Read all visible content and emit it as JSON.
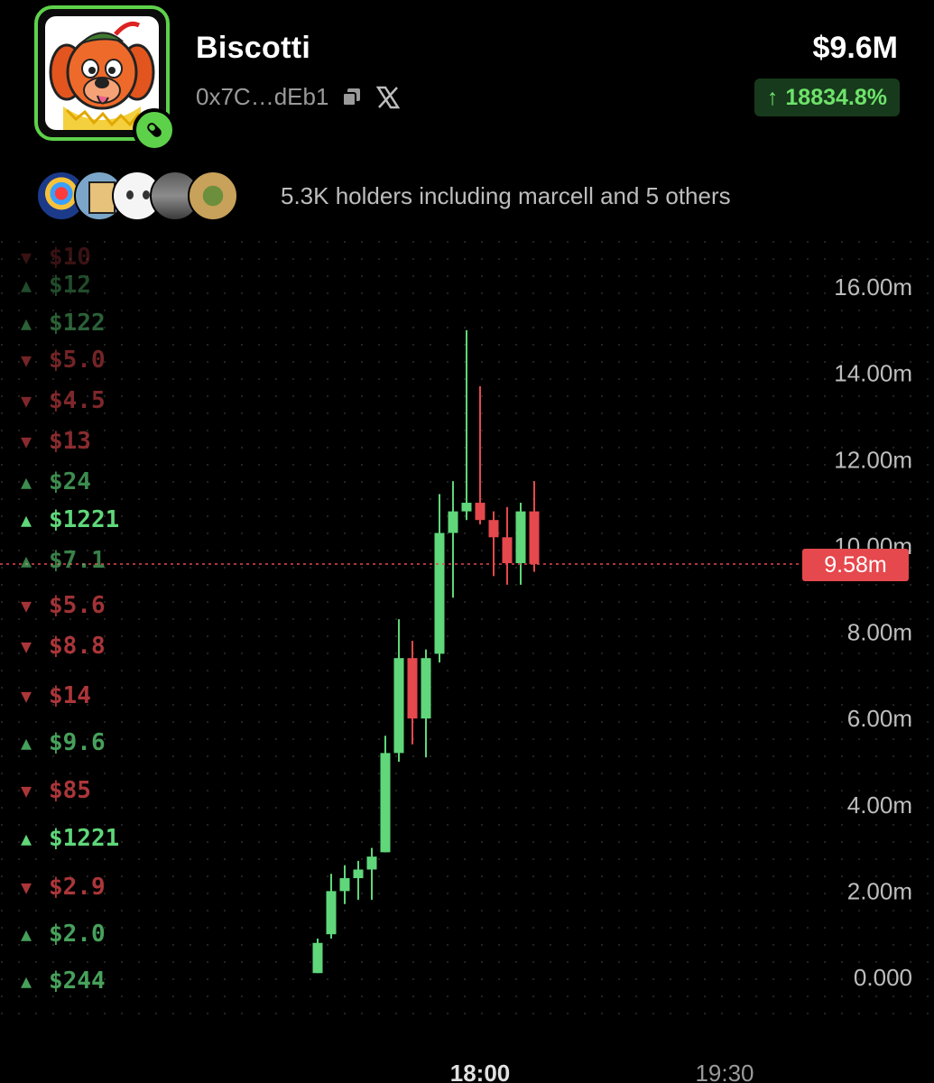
{
  "token": {
    "name": "Biscotti",
    "address": "0x7C…dEb1",
    "market_cap": "$9.6M",
    "change": "18834.8%",
    "change_arrow": "↑"
  },
  "holders": {
    "text": "5.3K holders including marcell and 5 others"
  },
  "trades": [
    {
      "dir": "down",
      "amount": "$10",
      "opacity": 0.25
    },
    {
      "dir": "up",
      "amount": "$12",
      "opacity": 0.35
    },
    {
      "dir": "up",
      "amount": "$122",
      "opacity": 0.45
    },
    {
      "dir": "down",
      "amount": "$5.0",
      "opacity": 0.5
    },
    {
      "dir": "down",
      "amount": "$4.5",
      "opacity": 0.55
    },
    {
      "dir": "down",
      "amount": "$13",
      "opacity": 0.6
    },
    {
      "dir": "up",
      "amount": "$24",
      "opacity": 0.65
    },
    {
      "dir": "up",
      "amount": "$1221",
      "opacity": 1
    },
    {
      "dir": "up",
      "amount": "$7.1",
      "opacity": 0.6
    },
    {
      "dir": "down",
      "amount": "$5.6",
      "opacity": 0.7
    },
    {
      "dir": "down",
      "amount": "$8.8",
      "opacity": 0.75
    },
    {
      "dir": "down",
      "amount": "$14",
      "opacity": 0.75
    },
    {
      "dir": "up",
      "amount": "$9.6",
      "opacity": 0.75
    },
    {
      "dir": "down",
      "amount": "$85",
      "opacity": 0.75
    },
    {
      "dir": "up",
      "amount": "$1221",
      "opacity": 1
    },
    {
      "dir": "down",
      "amount": "$2.9",
      "opacity": 0.75
    },
    {
      "dir": "up",
      "amount": "$2.0",
      "opacity": 0.75
    },
    {
      "dir": "up",
      "amount": "$244",
      "opacity": 0.75
    }
  ],
  "colors": {
    "up": "#5fd77a",
    "down": "#e5484d",
    "accent": "#5ed14b",
    "grid_dot": "#262626"
  },
  "icons": {
    "copy": "copy-icon",
    "x": "x-logo-icon",
    "pill": "pill-icon"
  },
  "chart_data": {
    "type": "candlestick",
    "y_ticks": [
      "16.00m",
      "14.00m",
      "12.00m",
      "10.00m",
      "8.00m",
      "6.00m",
      "4.00m",
      "2.00m",
      "0.000"
    ],
    "ylim": [
      0,
      16
    ],
    "x_ticks": [
      "18:00",
      "19:30"
    ],
    "current_price_label": "9.58m",
    "current_price": 9.58,
    "candles": [
      {
        "o": 0.1,
        "h": 0.9,
        "l": 0.1,
        "c": 0.8
      },
      {
        "o": 1.0,
        "h": 2.4,
        "l": 0.9,
        "c": 2.0
      },
      {
        "o": 2.0,
        "h": 2.6,
        "l": 1.7,
        "c": 2.3
      },
      {
        "o": 2.3,
        "h": 2.7,
        "l": 1.8,
        "c": 2.5
      },
      {
        "o": 2.5,
        "h": 3.0,
        "l": 1.8,
        "c": 2.8
      },
      {
        "o": 2.9,
        "h": 5.6,
        "l": 2.9,
        "c": 5.2
      },
      {
        "o": 5.2,
        "h": 8.3,
        "l": 5.0,
        "c": 7.4
      },
      {
        "o": 7.4,
        "h": 7.8,
        "l": 5.4,
        "c": 6.0
      },
      {
        "o": 6.0,
        "h": 7.6,
        "l": 5.1,
        "c": 7.4
      },
      {
        "o": 7.5,
        "h": 11.2,
        "l": 7.3,
        "c": 10.3
      },
      {
        "o": 10.3,
        "h": 11.5,
        "l": 8.8,
        "c": 10.8
      },
      {
        "o": 10.8,
        "h": 15.0,
        "l": 10.6,
        "c": 11.0
      },
      {
        "o": 11.0,
        "h": 13.7,
        "l": 10.5,
        "c": 10.6
      },
      {
        "o": 10.6,
        "h": 10.8,
        "l": 9.3,
        "c": 10.2
      },
      {
        "o": 10.2,
        "h": 10.9,
        "l": 9.1,
        "c": 9.6
      },
      {
        "o": 9.6,
        "h": 11.0,
        "l": 9.1,
        "c": 10.8
      },
      {
        "o": 10.8,
        "h": 11.5,
        "l": 9.4,
        "c": 9.58
      }
    ]
  }
}
